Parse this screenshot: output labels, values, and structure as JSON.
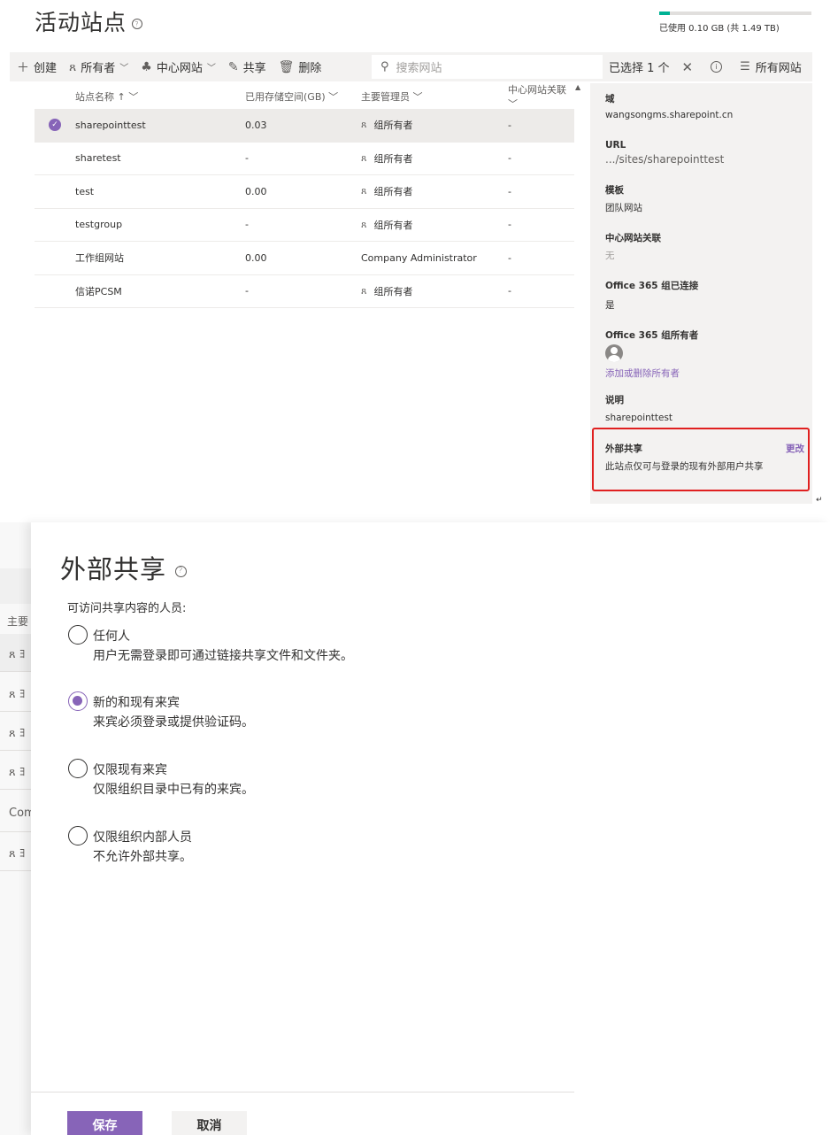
{
  "header": {
    "title": "活动站点",
    "help_glyph": "?",
    "storage_text": "已使用 0.10 GB (共 1.49 TB)",
    "storage_used_fraction": 0.067
  },
  "toolbar": {
    "create": "创建",
    "owner": "所有者",
    "hub": "中心网站",
    "share": "共享",
    "delete": "删除",
    "search_placeholder": "搜索网站",
    "selected": "已选择 1 个",
    "view": "所有网站"
  },
  "grid": {
    "columns": [
      "站点名称 ↑",
      "已用存储空间(GB)",
      "主要管理员",
      "中心网站关联"
    ],
    "rows": [
      {
        "name": "sharepointtest",
        "storage": "0.03",
        "admin": "组所有者",
        "hub": "-",
        "selected": true
      },
      {
        "name": "sharetest",
        "storage": "-",
        "admin": "组所有者",
        "hub": "-"
      },
      {
        "name": "test",
        "storage": "0.00",
        "admin": "组所有者",
        "hub": "-"
      },
      {
        "name": "testgroup",
        "storage": "-",
        "admin": "组所有者",
        "hub": "-"
      },
      {
        "name": "工作组网站",
        "storage": "0.00",
        "admin": "Company Administrator",
        "hub": "-"
      },
      {
        "name": "信诺PCSM",
        "storage": "-",
        "admin": "组所有者",
        "hub": "-"
      }
    ]
  },
  "details": {
    "domain_label": "域",
    "domain_value": "wangsongms.sharepoint.cn",
    "url_label": "URL",
    "url_value": ".../sites/sharepointtest",
    "template_label": "模板",
    "template_value": "团队网站",
    "hub_label": "中心网站关联",
    "hub_value": "无",
    "group_connected_label": "Office 365 组已连接",
    "group_connected_value": "是",
    "group_owner_label": "Office 365 组所有者",
    "group_owner_link": "添加或删除所有者",
    "description_label": "说明",
    "description_value": "sharepointtest",
    "external_label": "外部共享",
    "external_change": "更改",
    "external_value": "此站点仅可与登录的现有外部用户共享"
  },
  "background_fragments": {
    "header": "主要",
    "row_glyph": "ጸ ﾖ",
    "com": "Com"
  },
  "dialog": {
    "title": "外部共享",
    "subtitle": "可访问共享内容的人员:",
    "options": [
      {
        "title": "任何人",
        "desc": "用户无需登录即可通过链接共享文件和文件夹。",
        "checked": false
      },
      {
        "title": "新的和现有来宾",
        "desc": "来宾必须登录或提供验证码。",
        "checked": true
      },
      {
        "title": "仅限现有来宾",
        "desc": "仅限组织目录中已有的来宾。",
        "checked": false
      },
      {
        "title": "仅限组织内部人员",
        "desc": "不允许外部共享。",
        "checked": false
      }
    ],
    "save": "保存",
    "cancel": "取消"
  },
  "colors": {
    "accent": "#8764b8",
    "storage": "#00b294",
    "highlight_border": "#e02020"
  }
}
